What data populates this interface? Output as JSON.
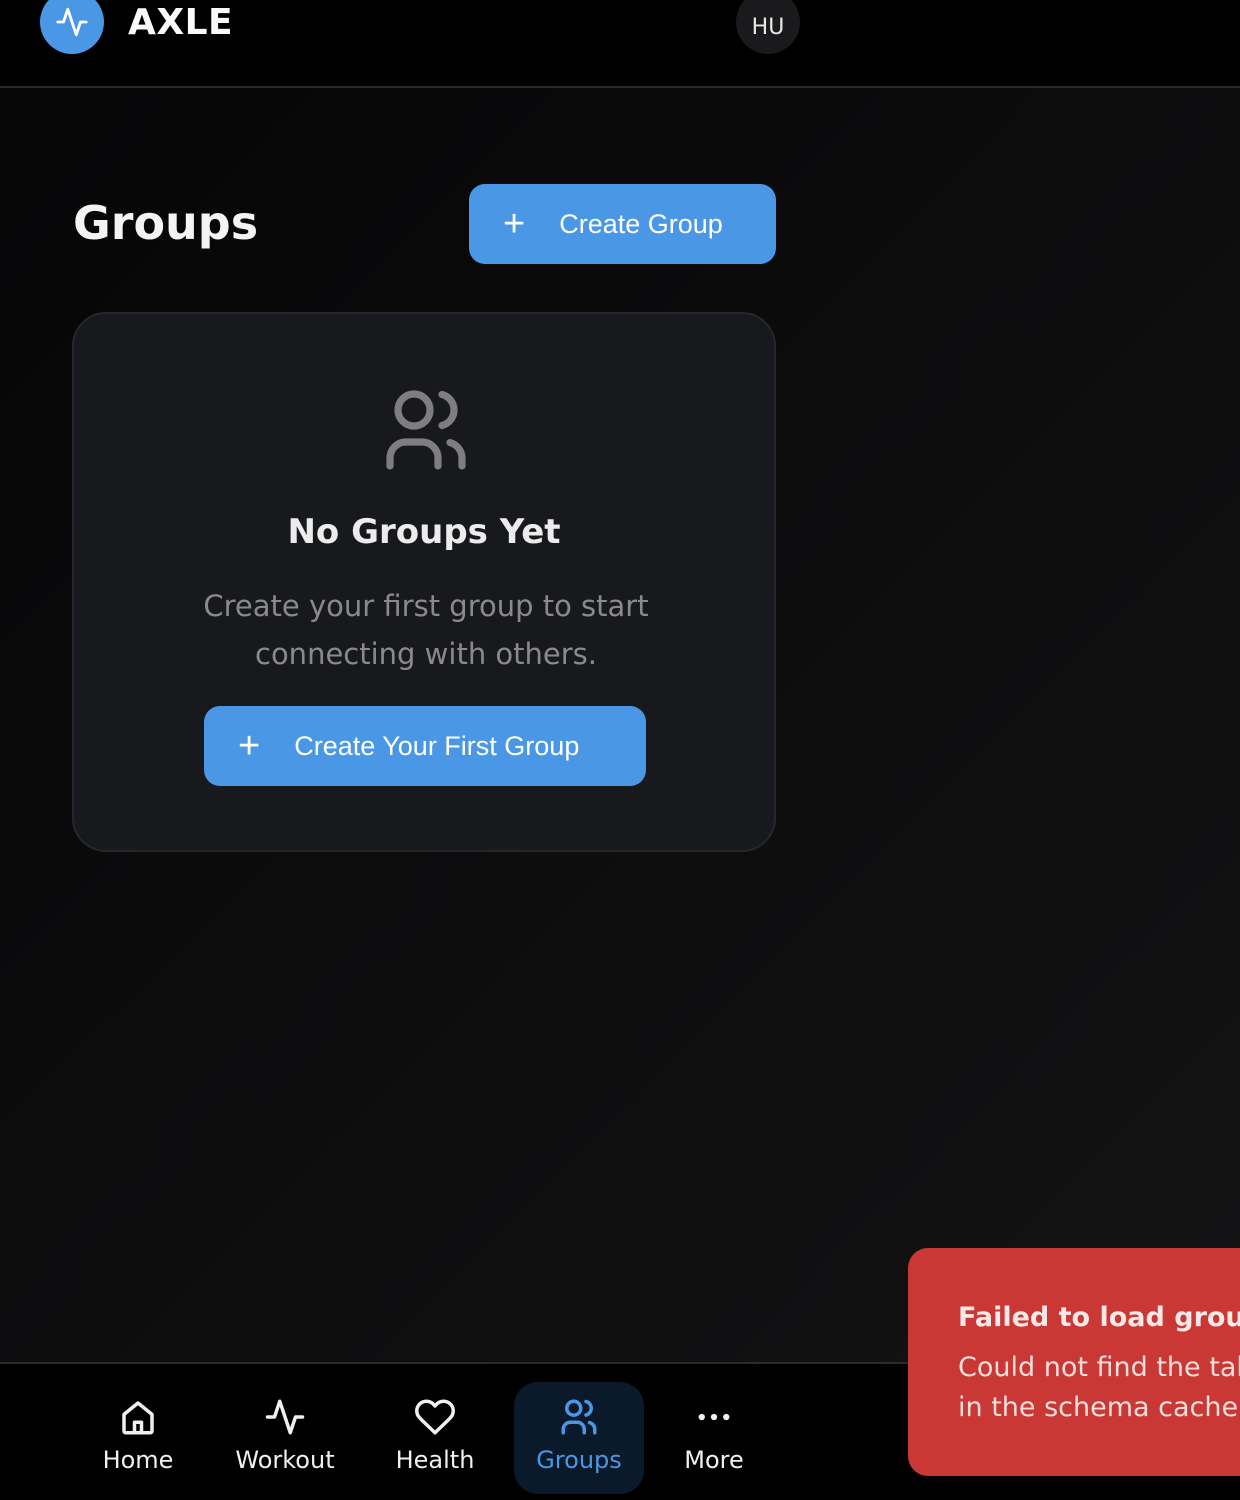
{
  "header": {
    "brand": "AXLE",
    "avatar_initials": "HU"
  },
  "main": {
    "title": "Groups",
    "create_button": "Create Group",
    "empty_state": {
      "title": "No Groups Yet",
      "description": "Create your first group to start connecting with others.",
      "button": "Create Your First Group"
    }
  },
  "nav": {
    "items": [
      {
        "label": "Home",
        "icon": "home-icon"
      },
      {
        "label": "Workout",
        "icon": "activity-icon"
      },
      {
        "label": "Health",
        "icon": "heart-icon"
      },
      {
        "label": "Groups",
        "icon": "users-icon",
        "active": true
      },
      {
        "label": "More",
        "icon": "more-icon"
      }
    ]
  },
  "toast": {
    "title": "Failed to load groups",
    "message_line1": "Could not find the tab",
    "message_line2": "in the schema cache"
  },
  "colors": {
    "accent": "#4a97e6",
    "error": "#c93834",
    "background": "#0a0a0b",
    "card": "#18191d"
  }
}
